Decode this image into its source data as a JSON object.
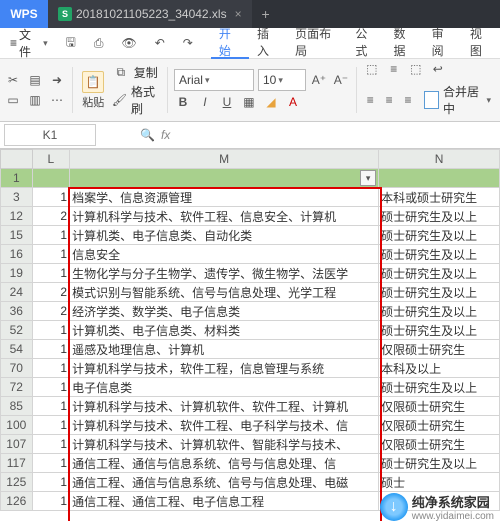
{
  "app": {
    "logo": "WPS"
  },
  "filetab": {
    "icon": "S",
    "name": "20181021105223_34042.xls",
    "close": "×",
    "plus": "+"
  },
  "menu": {
    "file": "文件",
    "tabs": [
      "开始",
      "插入",
      "页面布局",
      "公式",
      "数据",
      "审阅",
      "视图"
    ],
    "active_index": 0
  },
  "ribbon": {
    "paste": "粘贴",
    "copy": "复制",
    "fmt": "格式刷",
    "font_name": "Arial",
    "font_size": "10",
    "merge": "合并居中"
  },
  "namebox": {
    "cell": "K1",
    "fx": "fx"
  },
  "columns": [
    "L",
    "M",
    "N"
  ],
  "rows": [
    {
      "n": "1",
      "L": "",
      "M": "",
      "N": "",
      "green": true
    },
    {
      "n": "3",
      "L": "1",
      "M": "档案学、信息资源管理",
      "N": "本科或硕士研究生"
    },
    {
      "n": "12",
      "L": "2",
      "M": "计算机科学与技术、软件工程、信息安全、计算机",
      "N": "硕士研究生及以上"
    },
    {
      "n": "15",
      "L": "1",
      "M": "计算机类、电子信息类、自动化类",
      "N": "硕士研究生及以上"
    },
    {
      "n": "16",
      "L": "1",
      "M": "信息安全",
      "N": "硕士研究生及以上"
    },
    {
      "n": "19",
      "L": "1",
      "M": "生物化学与分子生物学、遗传学、微生物学、法医学",
      "N": "硕士研究生及以上"
    },
    {
      "n": "24",
      "L": "2",
      "M": "模式识别与智能系统、信号与信息处理、光学工程",
      "N": "硕士研究生及以上"
    },
    {
      "n": "36",
      "L": "2",
      "M": "经济学类、数学类、电子信息类",
      "N": "硕士研究生及以上"
    },
    {
      "n": "52",
      "L": "1",
      "M": "计算机类、电子信息类、材料类",
      "N": "硕士研究生及以上"
    },
    {
      "n": "54",
      "L": "1",
      "M": "遥感及地理信息、计算机",
      "N": "仅限硕士研究生"
    },
    {
      "n": "70",
      "L": "1",
      "M": "计算机科学与技术，软件工程，信息管理与系统",
      "N": "本科及以上"
    },
    {
      "n": "72",
      "L": "1",
      "M": "电子信息类",
      "N": "硕士研究生及以上"
    },
    {
      "n": "85",
      "L": "1",
      "M": "计算机科学与技术、计算机软件、软件工程、计算机",
      "N": "仅限硕士研究生"
    },
    {
      "n": "100",
      "L": "1",
      "M": "计算机科学与技术、软件工程、电子科学与技术、信",
      "N": "仅限硕士研究生"
    },
    {
      "n": "107",
      "L": "1",
      "M": "计算机科学与技术、计算机软件、智能科学与技术、",
      "N": "仅限硕士研究生"
    },
    {
      "n": "117",
      "L": "1",
      "M": "通信工程、通信与信息系统、信号与信息处理、信",
      "N": "硕士研究生及以上"
    },
    {
      "n": "125",
      "L": "1",
      "M": "通信工程、通信与信息系统、信号与信息处理、电磁",
      "N": "硕士"
    },
    {
      "n": "126",
      "L": "1",
      "M": "通信工程、通信工程、电子信息工程",
      "N": ""
    }
  ],
  "watermark": {
    "brand": "纯净系统家园",
    "url": "www.yidaimei.com"
  }
}
